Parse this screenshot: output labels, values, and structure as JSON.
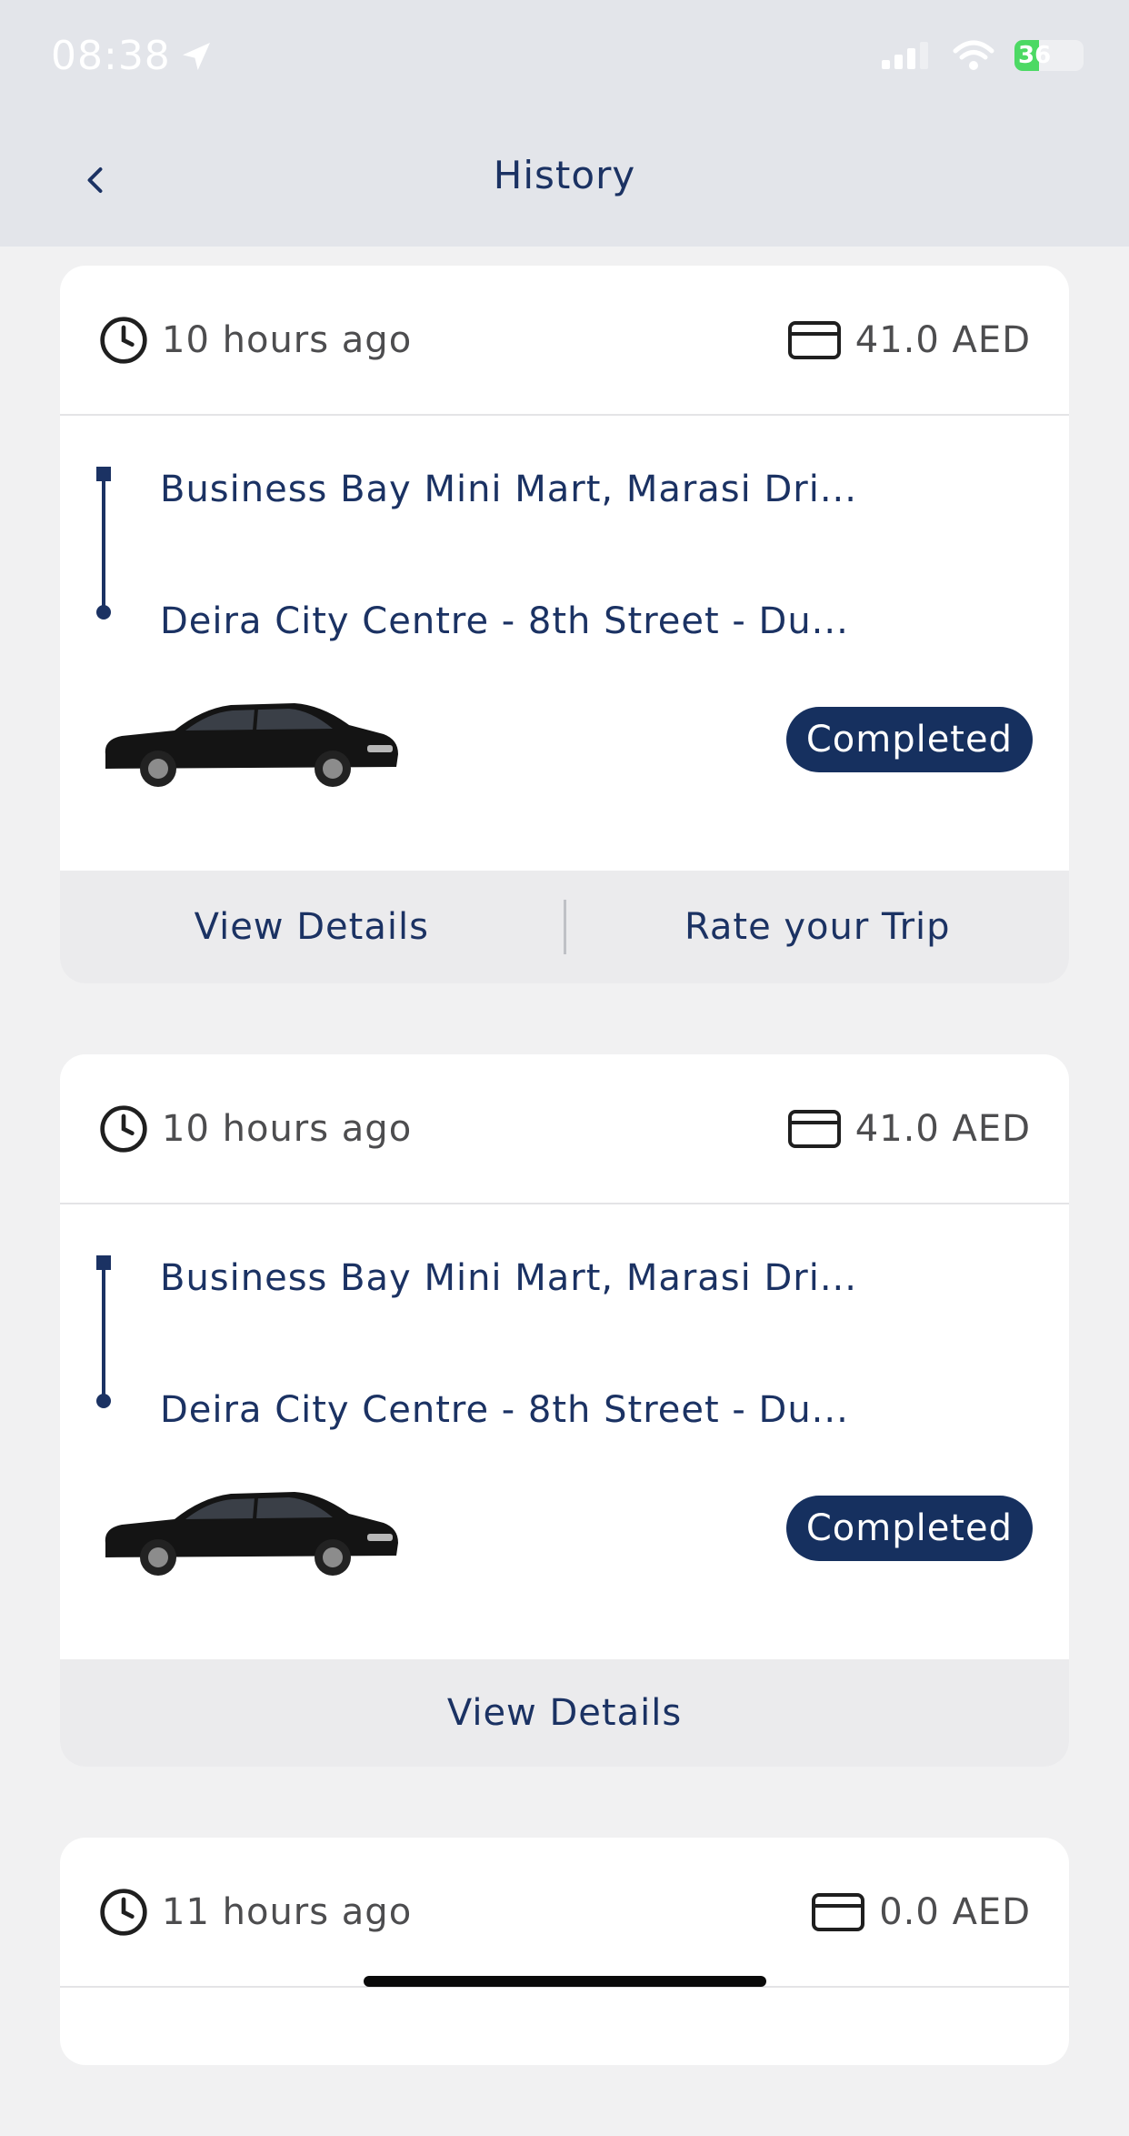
{
  "status_bar": {
    "time": "08:38",
    "battery": "36"
  },
  "header": {
    "title": "History"
  },
  "trips": [
    {
      "time_ago": "10 hours ago",
      "price": "41.0 AED",
      "pickup": "Business Bay Mini Mart, Marasi Dri...",
      "dropoff": "Deira City Centre - 8th Street - Du...",
      "status": "Completed",
      "actions": [
        "View Details",
        "Rate your Trip"
      ]
    },
    {
      "time_ago": "10 hours ago",
      "price": "41.0 AED",
      "pickup": "Business Bay Mini Mart, Marasi Dri...",
      "dropoff": "Deira City Centre - 8th Street - Du...",
      "status": "Completed",
      "actions": [
        "View Details"
      ]
    },
    {
      "time_ago": "11 hours ago",
      "price": "0.0 AED"
    }
  ],
  "colors": {
    "primary": "#1b3263",
    "badge": "#16305f",
    "header_bg": "#e3e5ea",
    "page_bg": "#f1f1f2",
    "battery": "#4cd964"
  },
  "icons": [
    "chevron-left-icon",
    "clock-icon",
    "card-icon",
    "location-arrow-icon",
    "signal-icon",
    "wifi-icon",
    "battery-icon"
  ]
}
